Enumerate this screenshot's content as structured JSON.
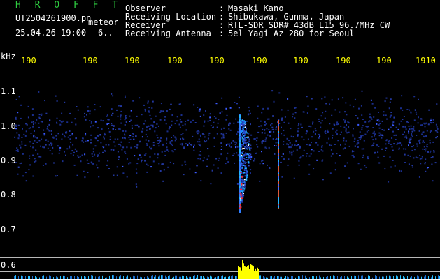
{
  "app": {
    "title": "H R O F F T"
  },
  "file": {
    "name": "UT2504261900.pn",
    "tag": "meteor",
    "datetime": "25.04.26 19:00",
    "extra": "6.."
  },
  "info": {
    "rows": [
      {
        "label": "Observer",
        "value": "Masaki Kano"
      },
      {
        "label": "Receiving Location",
        "value": "Shibukawa, Gunma, Japan"
      },
      {
        "label": "Receiver",
        "value": "RTL-SDR SDR# 43dB L15 96.7MHz CW"
      },
      {
        "label": "Receiving Antenna",
        "value": "5el Yagi Az 280 for Seoul"
      }
    ],
    "separator": ":"
  },
  "axis": {
    "unit": "kHz",
    "y_ticks": [
      "1.1",
      "1.0",
      "0.9",
      "0.8",
      "0.7",
      "0.6"
    ],
    "time_ticks": [
      "190",
      "190",
      "190",
      "190",
      "190",
      "190",
      "190",
      "190",
      "190",
      "1910"
    ]
  },
  "colors": {
    "background": "#000000",
    "text": "#ffffff",
    "title": "#2ecc40",
    "time_labels": "#ffff00",
    "noise": "#1a2e8c",
    "echo_core": "#ffffff",
    "echo_mid": "#21b5ff",
    "echo_hot": "#ff2a2a",
    "amplitude": "#ffff00"
  }
}
